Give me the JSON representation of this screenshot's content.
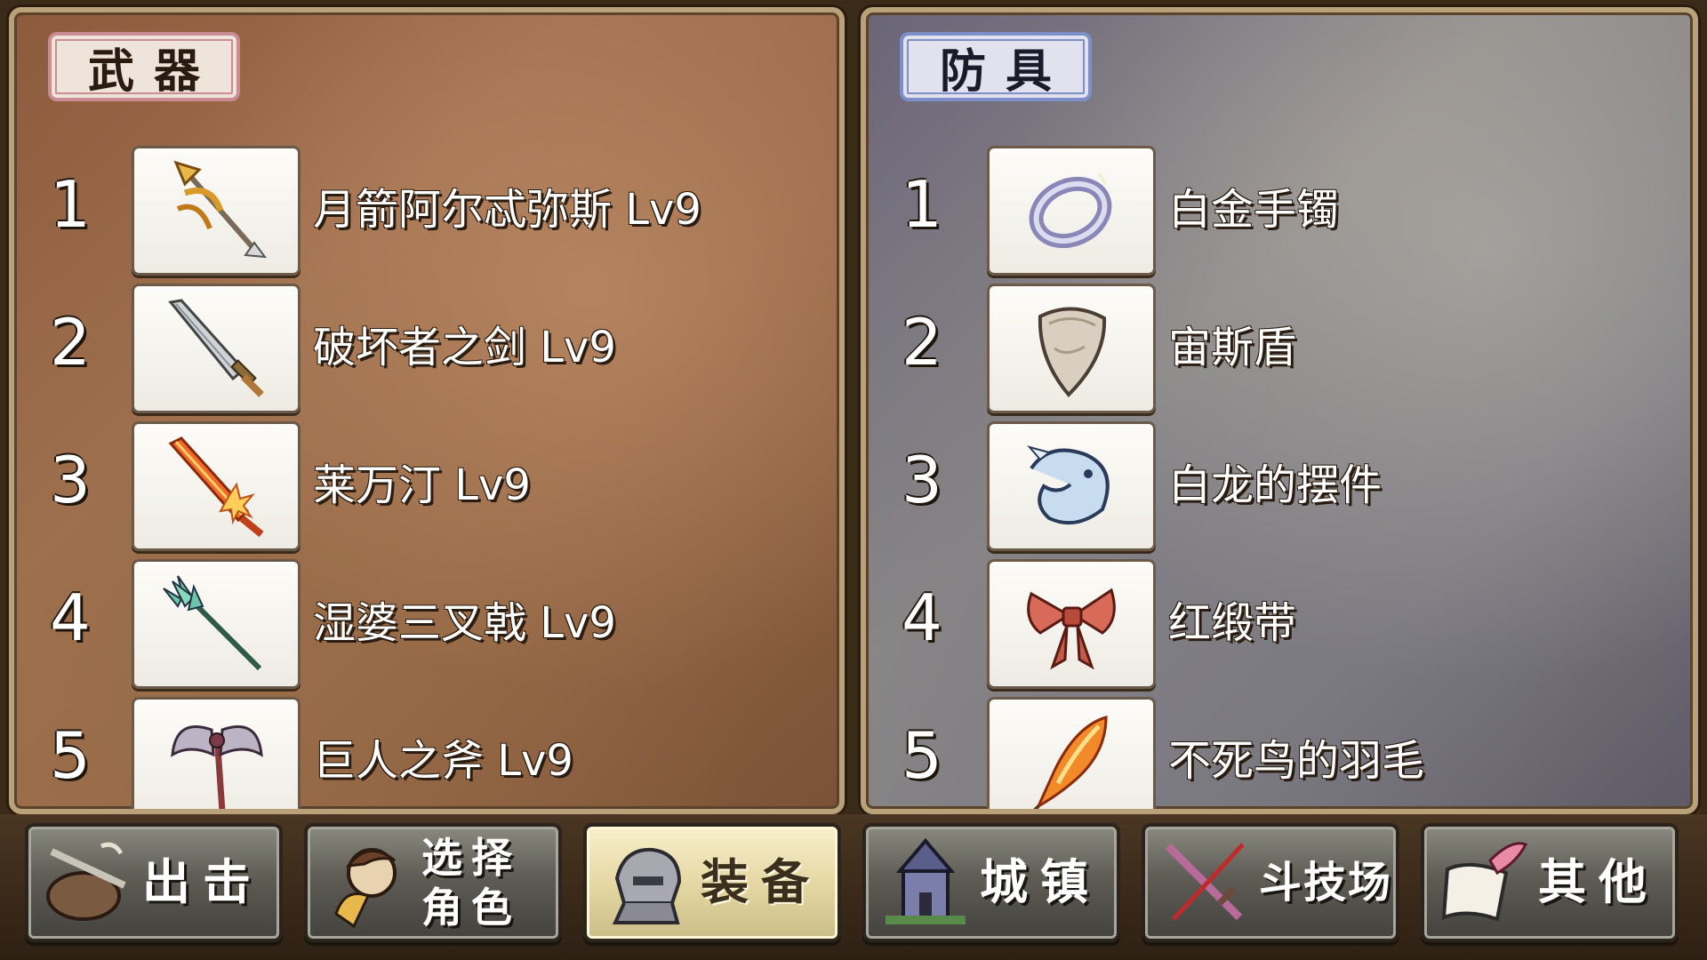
{
  "weapons": {
    "title": "武器",
    "items": [
      {
        "num": "1",
        "name": "月箭阿尔忒弥斯 Lv9",
        "icon": "golden-bow-arrow-icon"
      },
      {
        "num": "2",
        "name": "破坏者之剑 Lv9",
        "icon": "sword-icon"
      },
      {
        "num": "3",
        "name": "莱万汀 Lv9",
        "icon": "flame-sword-icon"
      },
      {
        "num": "4",
        "name": "湿婆三叉戟 Lv9",
        "icon": "trident-icon"
      },
      {
        "num": "5",
        "name": "巨人之斧 Lv9",
        "icon": "battle-axe-icon"
      }
    ]
  },
  "armor": {
    "title": "防具",
    "items": [
      {
        "num": "1",
        "name": "白金手镯",
        "icon": "platinum-bracelet-icon"
      },
      {
        "num": "2",
        "name": "宙斯盾",
        "icon": "shield-icon"
      },
      {
        "num": "3",
        "name": "白龙的摆件",
        "icon": "white-dragon-icon"
      },
      {
        "num": "4",
        "name": "红缎带",
        "icon": "red-ribbon-icon"
      },
      {
        "num": "5",
        "name": "不死鸟的羽毛",
        "icon": "phoenix-feather-icon"
      }
    ]
  },
  "menu": {
    "sortie": "出击",
    "select_line1": "选择",
    "select_line2": "角色",
    "equip": "装备",
    "town": "城镇",
    "arena": "斗技场",
    "other": "其他",
    "active": "equip"
  }
}
